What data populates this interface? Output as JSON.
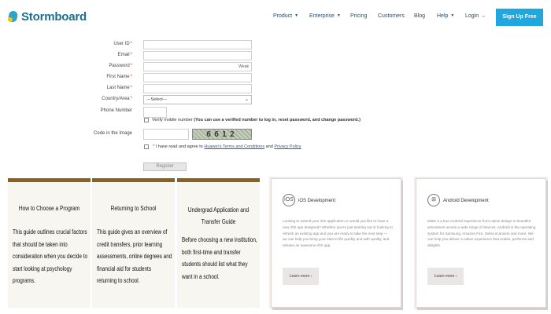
{
  "header": {
    "logo_text": "Stormboard",
    "nav": [
      {
        "label": "Product",
        "caret": "▼"
      },
      {
        "label": "Enterprise",
        "caret": "▼"
      },
      {
        "label": "Pricing",
        "caret": ""
      },
      {
        "label": "Customers",
        "caret": ""
      },
      {
        "label": "Blog",
        "caret": ""
      },
      {
        "label": "Help",
        "caret": "▼"
      },
      {
        "label": "Login →",
        "caret": ""
      }
    ],
    "signup_label": "Sign Up Free",
    "signup_color": "#1fa8e0"
  },
  "form": {
    "user_id_label": "User ID",
    "email_label": "Email",
    "password_label": "Password",
    "password_hint": "Weak",
    "first_name_label": "First Name",
    "last_name_label": "Last Name",
    "country_label": "Country/Area",
    "country_value": "---Select---",
    "phone_label": "Phone Number",
    "verify_text_plain": "Verify mobile number",
    "verify_text_bold": "(You can use a verified number to log in, reset password, and change password.)",
    "code_label": "Code in the Image",
    "captcha_text": "6612",
    "terms_prefix": "I have read and agree to",
    "terms_link": "Huawei's Terms and Conditions",
    "terms_and": "and",
    "privacy_link": "Privacy Policy",
    "register_label": "Register"
  },
  "cards": [
    {
      "title": "How to Choose a Program",
      "body": "This guide outlines crucial factors that should be taken into consideration when you decide to start looking at psychology programs."
    },
    {
      "title": "Returning to School",
      "body": "This guide gives an overview of credit transfers, prior learning assessments, online degrees and financial aid for students returning to school."
    },
    {
      "title": "Undergrad Application and Transfer Guide",
      "body": "Before choosing a new institution, both first-time and transfer students should list what they want in a school."
    }
  ],
  "dev_cards": [
    {
      "icon": "iOS",
      "title": "iOS Development",
      "body": "Looking to extend your iOS application or would you like to have a new iOS app designed? Whether you're just starting out or looking to refresh an existing app and you are ready to take the next step — we can help you bring your idea to life quickly and with quality, and release an awesome iOS app.",
      "button": "Learn more ›"
    },
    {
      "icon": "⊞",
      "title": "Android Development",
      "body": "Make it a true Android experience from native design to beautiful animations across a wide range of devices. Android is the operating system for Samsung, Amazon Fire, Zebra scanners and more. We can help you deliver a native experience that scales, performs and delights.",
      "button": "Learn more ›"
    }
  ]
}
